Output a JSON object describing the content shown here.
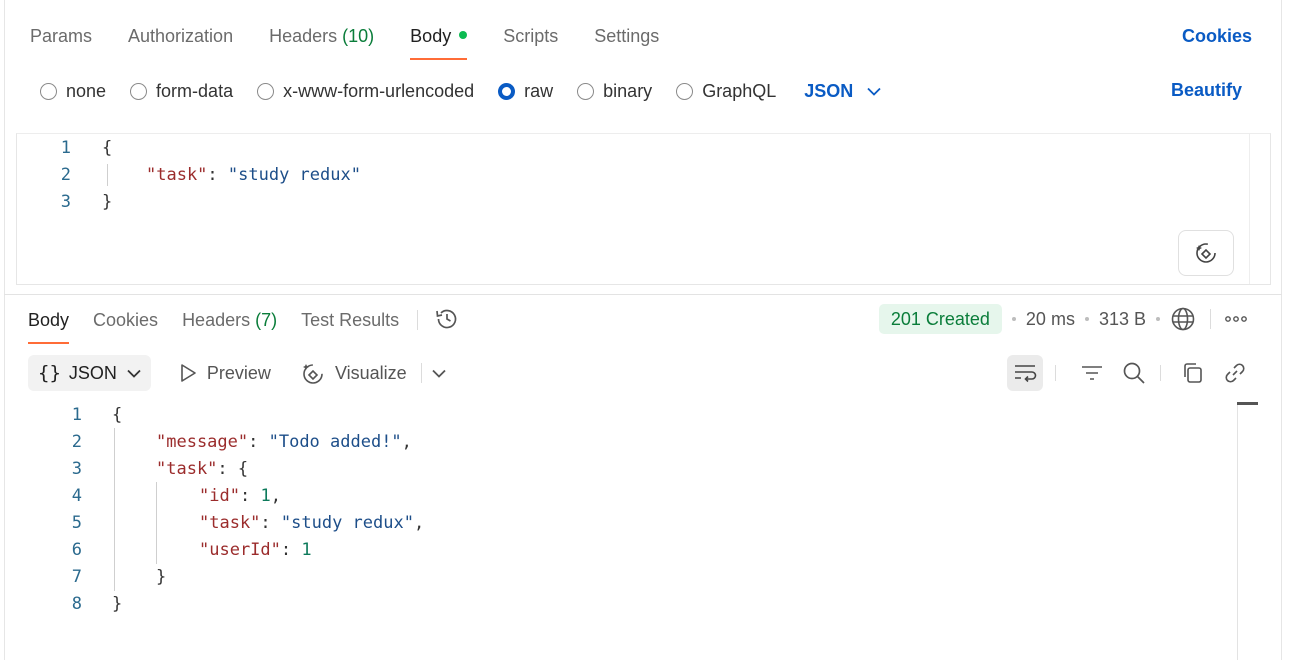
{
  "request": {
    "tabs": [
      {
        "label": "Params"
      },
      {
        "label": "Authorization"
      },
      {
        "label": "Headers",
        "count": "(10)"
      },
      {
        "label": "Body"
      },
      {
        "label": "Scripts"
      },
      {
        "label": "Settings"
      }
    ],
    "active_tab": "Body",
    "cookies_label": "Cookies",
    "body_modes": [
      "none",
      "form-data",
      "x-www-form-urlencoded",
      "raw",
      "binary",
      "GraphQL"
    ],
    "selected_mode": "raw",
    "language": "JSON",
    "beautify_label": "Beautify",
    "editor": {
      "line_numbers": [
        "1",
        "2",
        "3"
      ],
      "lines": {
        "l1": "{",
        "l2_key": "\"task\"",
        "l2_colon": ": ",
        "l2_value": "\"study redux\"",
        "l3": "}"
      }
    }
  },
  "response": {
    "tabs": [
      {
        "label": "Body"
      },
      {
        "label": "Cookies"
      },
      {
        "label": "Headers",
        "count": "(7)"
      },
      {
        "label": "Test Results"
      }
    ],
    "active_tab": "Body",
    "status": "201 Created",
    "time": "20 ms",
    "size": "313 B",
    "format": "JSON",
    "format_brace": "{}",
    "preview_label": "Preview",
    "visualize_label": "Visualize",
    "code": {
      "line_numbers": [
        "1",
        "2",
        "3",
        "4",
        "5",
        "6",
        "7",
        "8"
      ],
      "lines": {
        "l1": "{",
        "l2_key": "\"message\"",
        "l2_colon": ": ",
        "l2_value": "\"Todo added!\"",
        "l2_comma": ",",
        "l3_key": "\"task\"",
        "l3_rest": ": {",
        "l4_key": "\"id\"",
        "l4_colon": ": ",
        "l4_value": "1",
        "l4_comma": ",",
        "l5_key": "\"task\"",
        "l5_colon": ": ",
        "l5_value": "\"study redux\"",
        "l5_comma": ",",
        "l6_key": "\"userId\"",
        "l6_colon": ": ",
        "l6_value": "1",
        "l7": "}",
        "l8": "}"
      }
    }
  },
  "colors": {
    "accent_blue": "#0a5bc4",
    "active_underline": "#ff6c37",
    "status_green": "#0a7d3a",
    "json_key": "#9b2c2c",
    "json_string": "#1d4e89",
    "json_number": "#0d7a5b"
  },
  "icons": [
    "history-icon",
    "globe-icon",
    "more-horizontal-icon",
    "chevron-down-icon",
    "play-icon",
    "visualize-icon",
    "wrap-lines-icon",
    "filter-icon",
    "search-icon",
    "copy-icon",
    "link-icon",
    "ai-assist-icon"
  ]
}
